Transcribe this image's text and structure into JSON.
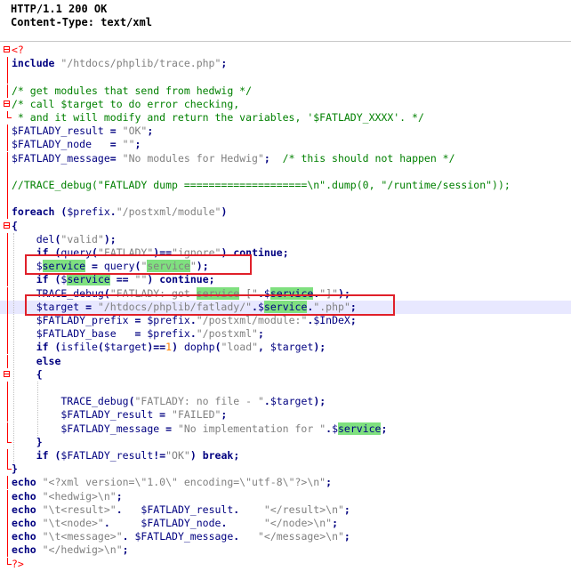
{
  "header": {
    "status_line": "HTTP/1.1 200 OK",
    "content_type": "Content-Type: text/xml"
  },
  "code_lines": [
    {
      "fold": "box",
      "parts": [
        {
          "t": "<?",
          "c": "php"
        }
      ]
    },
    {
      "fold": "vline",
      "parts": [
        {
          "t": "include ",
          "c": "kw"
        },
        {
          "t": "\"/htdocs/phplib/trace.php\"",
          "c": "str"
        },
        {
          "t": ";",
          "c": "op"
        }
      ]
    },
    {
      "fold": "vline",
      "parts": []
    },
    {
      "fold": "vline",
      "parts": [
        {
          "t": "/* get modules that send from hedwig */",
          "c": "cm"
        }
      ]
    },
    {
      "fold": "box",
      "parts": [
        {
          "t": "/* call $target to do error checking,",
          "c": "cm"
        }
      ]
    },
    {
      "fold": "end",
      "parts": [
        {
          "t": " * and it will modify and return the variables, '$FATLADY_XXXX'. */",
          "c": "cm"
        }
      ]
    },
    {
      "fold": "vline",
      "parts": [
        {
          "t": "$FATLADY_result ",
          "c": "var"
        },
        {
          "t": "= ",
          "c": "op"
        },
        {
          "t": "\"OK\"",
          "c": "str"
        },
        {
          "t": ";",
          "c": "op"
        }
      ]
    },
    {
      "fold": "vline",
      "parts": [
        {
          "t": "$FATLADY_node   ",
          "c": "var"
        },
        {
          "t": "= ",
          "c": "op"
        },
        {
          "t": "\"\"",
          "c": "str"
        },
        {
          "t": ";",
          "c": "op"
        }
      ]
    },
    {
      "fold": "vline",
      "parts": [
        {
          "t": "$FATLADY_message",
          "c": "var"
        },
        {
          "t": "= ",
          "c": "op"
        },
        {
          "t": "\"No modules for Hedwig\"",
          "c": "str"
        },
        {
          "t": ";  ",
          "c": "op"
        },
        {
          "t": "/* this should not happen */",
          "c": "cm"
        }
      ]
    },
    {
      "fold": "vline",
      "parts": []
    },
    {
      "fold": "vline",
      "parts": [
        {
          "t": "//TRACE_debug(\"FATLADY dump ====================\\n\".dump(0, \"/runtime/session\"));",
          "c": "cm"
        }
      ]
    },
    {
      "fold": "vline",
      "parts": []
    },
    {
      "fold": "vline",
      "parts": [
        {
          "t": "foreach ",
          "c": "kw"
        },
        {
          "t": "(",
          "c": "op"
        },
        {
          "t": "$prefix",
          "c": "var"
        },
        {
          "t": ".",
          "c": "op"
        },
        {
          "t": "\"/postxml/module\"",
          "c": "str"
        },
        {
          "t": ")",
          "c": "op"
        }
      ]
    },
    {
      "fold": "box",
      "parts": [
        {
          "t": "{",
          "c": "op"
        }
      ]
    },
    {
      "fold": "vline",
      "parts": [
        {
          "t": "    del",
          "c": "fn"
        },
        {
          "t": "(",
          "c": "op"
        },
        {
          "t": "\"valid\"",
          "c": "str"
        },
        {
          "t": ");",
          "c": "op"
        }
      ]
    },
    {
      "fold": "vline",
      "parts": [
        {
          "t": "    if ",
          "c": "kw"
        },
        {
          "t": "(",
          "c": "op"
        },
        {
          "t": "query",
          "c": "fn"
        },
        {
          "t": "(",
          "c": "op"
        },
        {
          "t": "\"FATLADY\"",
          "c": "str"
        },
        {
          "t": ")==",
          "c": "op"
        },
        {
          "t": "\"ignore\"",
          "c": "str"
        },
        {
          "t": ") ",
          "c": "op"
        },
        {
          "t": "continue",
          "c": "kw"
        },
        {
          "t": ";",
          "c": "op"
        }
      ]
    },
    {
      "fold": "vline",
      "parts": [
        {
          "t": "    $",
          "c": "var"
        },
        {
          "t": "service",
          "c": "var hl"
        },
        {
          "t": " = ",
          "c": "op"
        },
        {
          "t": "query",
          "c": "fn"
        },
        {
          "t": "(",
          "c": "op"
        },
        {
          "t": "\"",
          "c": "str"
        },
        {
          "t": "service",
          "c": "str hl"
        },
        {
          "t": "\"",
          "c": "str"
        },
        {
          "t": ");",
          "c": "op"
        }
      ]
    },
    {
      "fold": "vline",
      "parts": [
        {
          "t": "    if ",
          "c": "kw"
        },
        {
          "t": "(",
          "c": "op"
        },
        {
          "t": "$",
          "c": "var"
        },
        {
          "t": "service",
          "c": "var hl"
        },
        {
          "t": " == ",
          "c": "op"
        },
        {
          "t": "\"\"",
          "c": "str"
        },
        {
          "t": ") ",
          "c": "op"
        },
        {
          "t": "continue",
          "c": "kw"
        },
        {
          "t": ";",
          "c": "op"
        }
      ]
    },
    {
      "fold": "vline",
      "parts": [
        {
          "t": "    TRACE_debug",
          "c": "fn"
        },
        {
          "t": "(",
          "c": "op"
        },
        {
          "t": "\"FATLADY: got ",
          "c": "str"
        },
        {
          "t": "service",
          "c": "str hl"
        },
        {
          "t": " [\"",
          "c": "str"
        },
        {
          "t": ".",
          "c": "op"
        },
        {
          "t": "$",
          "c": "var"
        },
        {
          "t": "service",
          "c": "var hl"
        },
        {
          "t": ".",
          "c": "op"
        },
        {
          "t": "\"]\"",
          "c": "str"
        },
        {
          "t": ");",
          "c": "op"
        }
      ]
    },
    {
      "fold": "vline",
      "current": true,
      "parts": [
        {
          "t": "    $target ",
          "c": "var"
        },
        {
          "t": "= ",
          "c": "op"
        },
        {
          "t": "\"/htdocs/phplib/fatlady/\"",
          "c": "str"
        },
        {
          "t": ".",
          "c": "op"
        },
        {
          "t": "$",
          "c": "var"
        },
        {
          "t": "service",
          "c": "var hl"
        },
        {
          "t": ".",
          "c": "op"
        },
        {
          "t": "\".php\"",
          "c": "str"
        },
        {
          "t": ";",
          "c": "op"
        }
      ]
    },
    {
      "fold": "vline",
      "parts": [
        {
          "t": "    $FATLADY_prefix ",
          "c": "var"
        },
        {
          "t": "= ",
          "c": "op"
        },
        {
          "t": "$prefix",
          "c": "var"
        },
        {
          "t": ".",
          "c": "op"
        },
        {
          "t": "\"/postxml/module:\"",
          "c": "str"
        },
        {
          "t": ".",
          "c": "op"
        },
        {
          "t": "$InDeX",
          "c": "var"
        },
        {
          "t": ";",
          "c": "op"
        }
      ]
    },
    {
      "fold": "vline",
      "parts": [
        {
          "t": "    $FATLADY_base   ",
          "c": "var"
        },
        {
          "t": "= ",
          "c": "op"
        },
        {
          "t": "$prefix",
          "c": "var"
        },
        {
          "t": ".",
          "c": "op"
        },
        {
          "t": "\"/postxml\"",
          "c": "str"
        },
        {
          "t": ";",
          "c": "op"
        }
      ]
    },
    {
      "fold": "vline",
      "parts": [
        {
          "t": "    if ",
          "c": "kw"
        },
        {
          "t": "(",
          "c": "op"
        },
        {
          "t": "isfile",
          "c": "fn"
        },
        {
          "t": "(",
          "c": "op"
        },
        {
          "t": "$target",
          "c": "var"
        },
        {
          "t": ")==",
          "c": "op"
        },
        {
          "t": "1",
          "c": "num"
        },
        {
          "t": ") ",
          "c": "op"
        },
        {
          "t": "dophp",
          "c": "fn"
        },
        {
          "t": "(",
          "c": "op"
        },
        {
          "t": "\"load\"",
          "c": "str"
        },
        {
          "t": ", ",
          "c": "op"
        },
        {
          "t": "$target",
          "c": "var"
        },
        {
          "t": ");",
          "c": "op"
        }
      ]
    },
    {
      "fold": "vline",
      "parts": [
        {
          "t": "    else",
          "c": "kw"
        }
      ]
    },
    {
      "fold": "box",
      "parts": [
        {
          "t": "    {",
          "c": "op"
        }
      ]
    },
    {
      "fold": "vline",
      "parts": []
    },
    {
      "fold": "vline",
      "parts": [
        {
          "t": "        TRACE_debug",
          "c": "fn"
        },
        {
          "t": "(",
          "c": "op"
        },
        {
          "t": "\"FATLADY: no file - \"",
          "c": "str"
        },
        {
          "t": ".",
          "c": "op"
        },
        {
          "t": "$target",
          "c": "var"
        },
        {
          "t": ");",
          "c": "op"
        }
      ]
    },
    {
      "fold": "vline",
      "parts": [
        {
          "t": "        $FATLADY_result ",
          "c": "var"
        },
        {
          "t": "= ",
          "c": "op"
        },
        {
          "t": "\"FAILED\"",
          "c": "str"
        },
        {
          "t": ";",
          "c": "op"
        }
      ]
    },
    {
      "fold": "vline",
      "parts": [
        {
          "t": "        $FATLADY_message ",
          "c": "var"
        },
        {
          "t": "= ",
          "c": "op"
        },
        {
          "t": "\"No implementation for \"",
          "c": "str"
        },
        {
          "t": ".",
          "c": "op"
        },
        {
          "t": "$",
          "c": "var"
        },
        {
          "t": "service",
          "c": "var hl"
        },
        {
          "t": ";",
          "c": "op"
        }
      ]
    },
    {
      "fold": "end",
      "parts": [
        {
          "t": "    }",
          "c": "op"
        }
      ]
    },
    {
      "fold": "vline",
      "parts": [
        {
          "t": "    if ",
          "c": "kw"
        },
        {
          "t": "(",
          "c": "op"
        },
        {
          "t": "$FATLADY_result",
          "c": "var"
        },
        {
          "t": "!=",
          "c": "op"
        },
        {
          "t": "\"OK\"",
          "c": "str"
        },
        {
          "t": ") ",
          "c": "op"
        },
        {
          "t": "break",
          "c": "kw"
        },
        {
          "t": ";",
          "c": "op"
        }
      ]
    },
    {
      "fold": "end",
      "parts": [
        {
          "t": "}",
          "c": "op"
        }
      ]
    },
    {
      "fold": "vline",
      "parts": [
        {
          "t": "echo ",
          "c": "kw"
        },
        {
          "t": "\"<?xml version=\\\"1.0\\\" encoding=\\\"utf-8\\\"?>\\n\"",
          "c": "str"
        },
        {
          "t": ";",
          "c": "op"
        }
      ]
    },
    {
      "fold": "vline",
      "parts": [
        {
          "t": "echo ",
          "c": "kw"
        },
        {
          "t": "\"<hedwig>\\n\"",
          "c": "str"
        },
        {
          "t": ";",
          "c": "op"
        }
      ]
    },
    {
      "fold": "vline",
      "parts": [
        {
          "t": "echo ",
          "c": "kw"
        },
        {
          "t": "\"\\t<result>\"",
          "c": "str"
        },
        {
          "t": ".   ",
          "c": "op"
        },
        {
          "t": "$FATLADY_result",
          "c": "var"
        },
        {
          "t": ".    ",
          "c": "op"
        },
        {
          "t": "\"</result>\\n\"",
          "c": "str"
        },
        {
          "t": ";",
          "c": "op"
        }
      ]
    },
    {
      "fold": "vline",
      "parts": [
        {
          "t": "echo ",
          "c": "kw"
        },
        {
          "t": "\"\\t<node>\"",
          "c": "str"
        },
        {
          "t": ".     ",
          "c": "op"
        },
        {
          "t": "$FATLADY_node",
          "c": "var"
        },
        {
          "t": ".      ",
          "c": "op"
        },
        {
          "t": "\"</node>\\n\"",
          "c": "str"
        },
        {
          "t": ";",
          "c": "op"
        }
      ]
    },
    {
      "fold": "vline",
      "parts": [
        {
          "t": "echo ",
          "c": "kw"
        },
        {
          "t": "\"\\t<message>\"",
          "c": "str"
        },
        {
          "t": ". ",
          "c": "op"
        },
        {
          "t": "$FATLADY_message",
          "c": "var"
        },
        {
          "t": ".   ",
          "c": "op"
        },
        {
          "t": "\"</message>\\n\"",
          "c": "str"
        },
        {
          "t": ";",
          "c": "op"
        }
      ]
    },
    {
      "fold": "vline",
      "parts": [
        {
          "t": "echo ",
          "c": "kw"
        },
        {
          "t": "\"</hedwig>\\n\"",
          "c": "str"
        },
        {
          "t": ";",
          "c": "op"
        }
      ]
    },
    {
      "fold": "end",
      "parts": [
        {
          "t": "?>",
          "c": "php"
        }
      ]
    }
  ],
  "colors": {
    "keyword": "#000080",
    "string": "#808080",
    "comment": "#008000",
    "php_tag": "#ff0000",
    "highlight": "#7fe07f",
    "annotation_box": "#e0202a",
    "current_line": "#e8e8ff"
  }
}
